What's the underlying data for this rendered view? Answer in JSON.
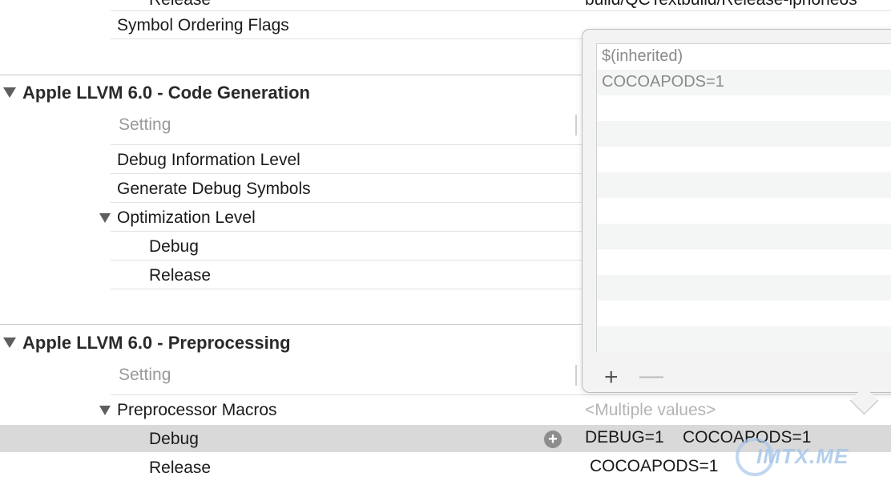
{
  "top": {
    "partial_release_label": "Release",
    "partial_release_value": "build/QCTextbuild/Release-iphoneos",
    "symbol_ordering_flags": "Symbol Ordering Flags"
  },
  "code_generation": {
    "title": "Apple LLVM 6.0 - Code Generation",
    "header_setting": "Setting",
    "rows": {
      "debug_information_level": "Debug Information Level",
      "generate_debug_symbols": "Generate Debug Symbols",
      "optimization_level": "Optimization Level",
      "debug": "Debug",
      "release": "Release"
    }
  },
  "preprocessing": {
    "title": "Apple LLVM 6.0 - Preprocessing",
    "header_setting": "Setting",
    "preprocessor_macros": "Preprocessor Macros",
    "multiple_values": "<Multiple values>",
    "debug_label": "Debug",
    "debug_value_1": "DEBUG=1",
    "debug_value_2": "COCOAPODS=1",
    "release_label": "Release",
    "release_value": "COCOAPODS=1"
  },
  "popover": {
    "items": [
      "$(inherited)",
      "COCOAPODS=1"
    ],
    "add_label": "+",
    "remove_label": "—"
  },
  "watermark": "IMTX.ME",
  "colors": {
    "selected_row": "#d9d9d9",
    "popover_bg": "#f3f3f3",
    "stripe": "#f4f5f5",
    "watermark": "#a7c6ea"
  }
}
